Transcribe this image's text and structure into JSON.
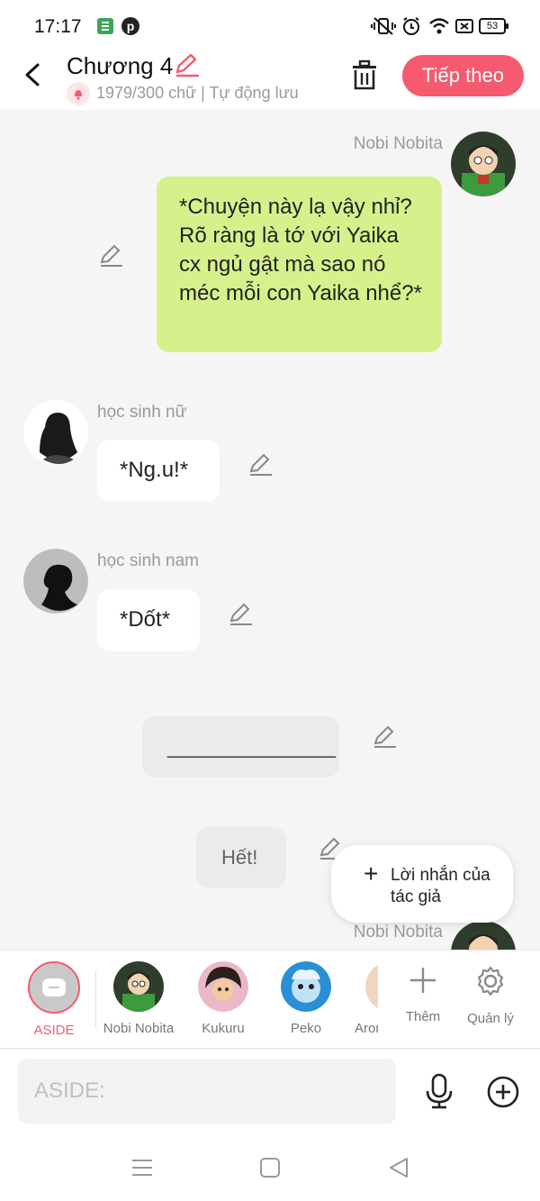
{
  "status_bar": {
    "time": "17:17",
    "battery": "53",
    "icons": [
      "app-notification-icon",
      "pinterest-icon",
      "vibrate-icon",
      "alarm-icon",
      "wifi-icon",
      "sim-icon",
      "battery-icon"
    ]
  },
  "header": {
    "title": "Chương 4",
    "subtitle": "1979/300 chữ | Tự động lưu",
    "next_label": "Tiếp theo",
    "accent": "#f55a6e"
  },
  "chat": {
    "messages": [
      {
        "speaker": "Nobi Nobita",
        "side": "right",
        "text": "*Chuyện này lạ vậy nhỉ? Rõ ràng là tớ với Yaika cx ngủ gật mà sao nó méc mỗi con Yaika nhể?*",
        "bubble_color": "#d6f18c"
      },
      {
        "speaker": "học sinh nữ",
        "side": "left",
        "text": "*Ng.u!*",
        "bubble_color": "#ffffff"
      },
      {
        "speaker": "học sinh nam",
        "side": "left",
        "text": "*Dốt*",
        "bubble_color": "#ffffff"
      },
      {
        "speaker": "",
        "side": "aside",
        "text": "______________",
        "bubble_color": "#ebebeb"
      },
      {
        "speaker": "",
        "side": "aside",
        "text": "Hết!",
        "bubble_color": "#ebebeb"
      },
      {
        "speaker": "Nobi Nobita",
        "side": "right",
        "text": "",
        "bubble_color": "#d6f18c"
      }
    ],
    "floating_button": {
      "plus": "+",
      "label": "Lời nhắn của tác giả"
    }
  },
  "characters": {
    "items": [
      {
        "label": "ASIDE",
        "selected": true
      },
      {
        "label": "Nobi Nobita",
        "selected": false
      },
      {
        "label": "Kukuru",
        "selected": false
      },
      {
        "label": "Peko",
        "selected": false
      },
      {
        "label": "Aron",
        "selected": false
      }
    ],
    "add_label": "Thêm",
    "manage_label": "Quản lý"
  },
  "input": {
    "placeholder": "ASIDE:",
    "value": ""
  }
}
